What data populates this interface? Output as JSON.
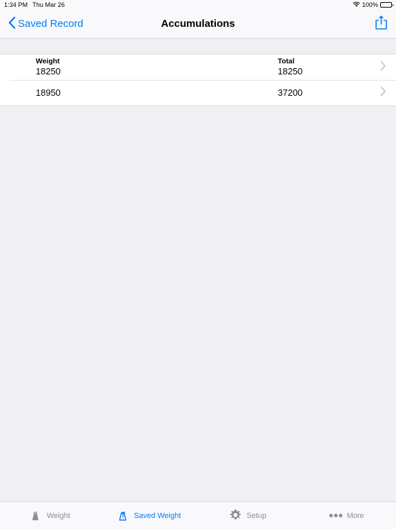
{
  "status_bar": {
    "time": "1:34 PM",
    "date": "Thu Mar 26",
    "wifi_icon": "wifi-icon",
    "battery_percent": "100%",
    "battery_icon": "battery-full-icon"
  },
  "nav_bar": {
    "back_icon": "chevron-left-icon",
    "back_label": "Saved Record",
    "title": "Accumulations",
    "share_icon": "share-icon"
  },
  "table": {
    "columns": {
      "weight": "Weight",
      "total": "Total"
    },
    "rows": [
      {
        "weight": "18250",
        "total": "18250",
        "show_headers": true,
        "disclosure_icon": "chevron-right-icon"
      },
      {
        "weight": "18950",
        "total": "37200",
        "show_headers": false,
        "disclosure_icon": "chevron-right-icon"
      }
    ]
  },
  "tab_bar": {
    "items": [
      {
        "label": "Weight",
        "icon": "weight-icon",
        "active": false
      },
      {
        "label": "Saved Weight",
        "icon": "saved-weight-icon",
        "active": true
      },
      {
        "label": "Setup",
        "icon": "gear-icon",
        "active": false
      },
      {
        "label": "More",
        "icon": "ellipsis-icon",
        "active": false
      }
    ]
  },
  "colors": {
    "accent": "#007aff",
    "inactive": "#8e8e93",
    "background": "#efeff4",
    "bar_background": "#f9f9fb",
    "row_background": "#ffffff",
    "separator": "#dcdce0"
  }
}
